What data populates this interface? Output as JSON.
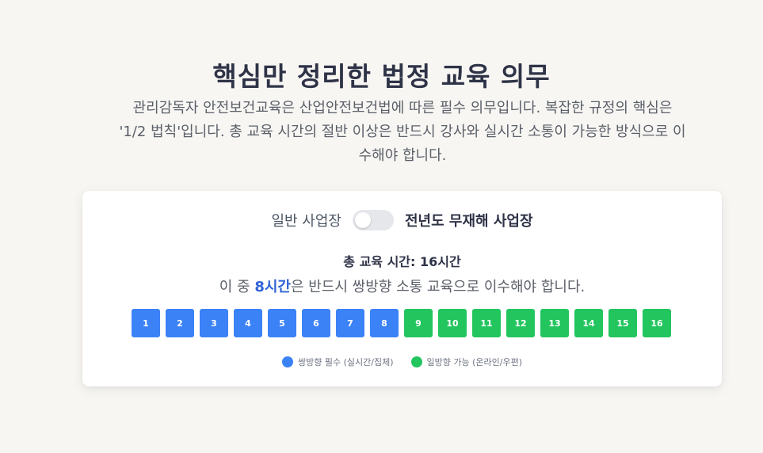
{
  "header": {
    "title": "핵심만 정리한 법정 교육 의무",
    "description": "관리감독자 안전보건교육은 산업안전보건법에 따른 필수 의무입니다. 복잡한 규정의 핵심은 '1/2 법칙'입니다. 총 교육 시간의 절반 이상은 반드시 강사와 실시간 소통이 가능한 방식으로 이수해야 합니다."
  },
  "toggle": {
    "left_label": "일반 사업장",
    "right_label": "전년도 무재해 사업장",
    "state": "off"
  },
  "summary": {
    "total_text": "총 교육 시간: 16시간",
    "sub_prefix": "이 중 ",
    "sub_highlight": "8시간",
    "sub_suffix": "은 반드시 쌍방향 소통 교육으로 이수해야 합니다."
  },
  "blocks": [
    {
      "label": "1",
      "type": "two_way"
    },
    {
      "label": "2",
      "type": "two_way"
    },
    {
      "label": "3",
      "type": "two_way"
    },
    {
      "label": "4",
      "type": "two_way"
    },
    {
      "label": "5",
      "type": "two_way"
    },
    {
      "label": "6",
      "type": "two_way"
    },
    {
      "label": "7",
      "type": "two_way"
    },
    {
      "label": "8",
      "type": "two_way"
    },
    {
      "label": "9",
      "type": "one_way"
    },
    {
      "label": "10",
      "type": "one_way"
    },
    {
      "label": "11",
      "type": "one_way"
    },
    {
      "label": "12",
      "type": "one_way"
    },
    {
      "label": "13",
      "type": "one_way"
    },
    {
      "label": "14",
      "type": "one_way"
    },
    {
      "label": "15",
      "type": "one_way"
    },
    {
      "label": "16",
      "type": "one_way"
    }
  ],
  "legend": {
    "two_way": "쌍방향 필수 (실시간/집체)",
    "one_way": "일방향 가능 (온라인/우편)"
  },
  "colors": {
    "two_way": "#3b82f6",
    "one_way": "#22c55e",
    "highlight": "#2f63d6"
  }
}
